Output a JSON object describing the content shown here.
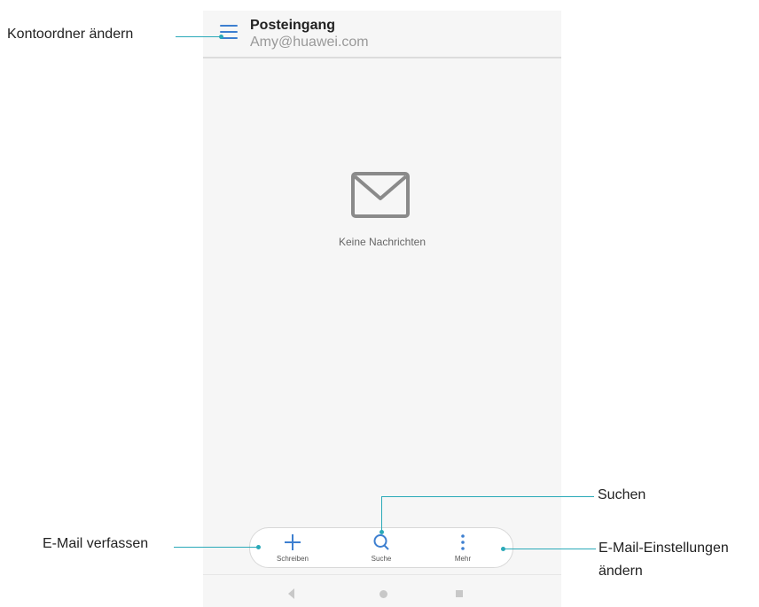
{
  "header": {
    "title": "Posteingang",
    "account": "Amy@huawei.com"
  },
  "empty_state": {
    "message": "Keine Nachrichten",
    "icon": "envelope-icon"
  },
  "bottom_bar": {
    "compose_label": "Schreiben",
    "search_label": "Suche",
    "more_label": "Mehr"
  },
  "callouts": {
    "account_folder": "Kontoordner ändern",
    "compose": "E-Mail verfassen",
    "search": "Suchen",
    "settings_line1": "E-Mail-Einstellungen",
    "settings_line2": "ändern"
  },
  "colors": {
    "accent": "#3d7fd0",
    "callout_line": "#2aa9b8"
  }
}
